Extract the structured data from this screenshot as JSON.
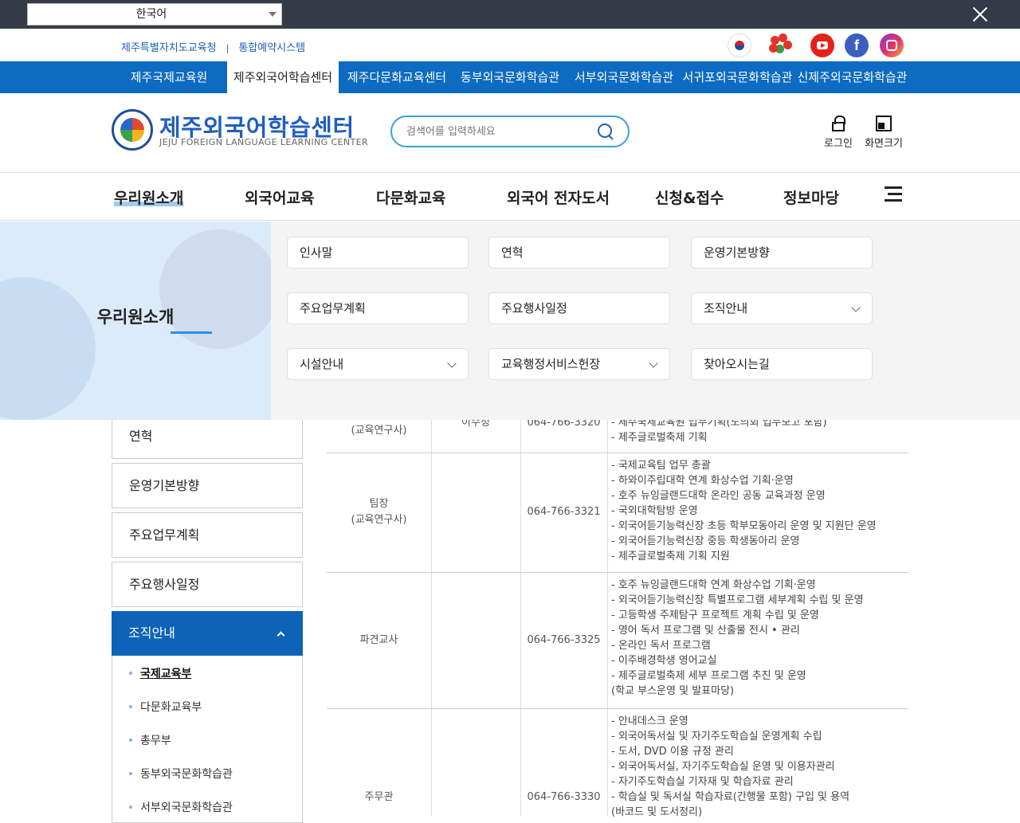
{
  "topbar": {
    "language": "한국어"
  },
  "util": {
    "links": [
      "제주특별자치도교육청",
      "통합예약시스템"
    ],
    "sep": "|"
  },
  "sites": [
    "제주국제교육원",
    "제주외국어학습센터",
    "제주다문화교육센터",
    "동부외국문화학습관",
    "서부외국문화학습관",
    "서귀포외국문화학습관",
    "신제주외국문화학습관"
  ],
  "header": {
    "logo_title": "제주외국어학습센터",
    "logo_sub": "JEJU FOREIGN LANGUAGE LEARNING CENTER",
    "search_placeholder": "검색어를 입력하세요",
    "login": "로그인",
    "zoom": "화면크기"
  },
  "gnb": [
    "우리원소개",
    "외국어교육",
    "다문화교육",
    "외국어 전자도서",
    "신청&접수",
    "정보마당"
  ],
  "mega": {
    "title": "우리원소개",
    "items": [
      "인사말",
      "연혁",
      "운영기본방향",
      "주요업무계획",
      "주요행사일정",
      "조직안내",
      "시설안내",
      "교육행정서비스헌장",
      "찾아오시는길"
    ]
  },
  "sidebar": {
    "items": [
      "연혁",
      "운영기본방향",
      "주요업무계획",
      "주요행사일정"
    ],
    "active": "조직안내",
    "sub": [
      "국제교육부",
      "다문화교육부",
      "총무부",
      "동부외국문화학습관",
      "서부외국문화학습관"
    ]
  },
  "table": {
    "rows": [
      {
        "position": "(교육연구사)",
        "name": "이수정",
        "phone": "064-766-3320",
        "duties": [
          "- 제주국제교육원 업무기획(도의회 업무보고 포함)",
          "- 제주글로벌축제 기획"
        ]
      },
      {
        "position": "팀장\n(교육연구사)",
        "name": "",
        "phone": "064-766-3321",
        "duties": [
          "- 국제교육팀 업무 총괄",
          "- 하와이주립대학 연계 화상수업 기획·운영",
          "- 호주 뉴잉글랜드대학 온라인 공동 교육과정 운영",
          "- 국외대학탐방 운영",
          "- 외국어듣기능력신장 초등 학부모동아리 운영 및 지원단 운영",
          "- 외국어듣기능력신장 중등 학생동아리 운영",
          "- 제주글로벌축제 기획 지원"
        ]
      },
      {
        "position": "파견교사",
        "name": "",
        "phone": "064-766-3325",
        "duties": [
          "- 호주 뉴잉글랜드대학 연계 화상수업 기획·운영",
          "- 외국어듣기능력신장 특별프로그램 세부계획 수립 및 운영",
          "- 고등학생 주제탐구 프로젝트 계획 수립 및 운영",
          "- 영어 독서 프로그램 및 산출물 전시 • 관리",
          "- 온라인 독서 프로그램",
          "- 이주배경학생 영어교실",
          "- 제주글로벌축제 세부 프로그램 추진 및 운영",
          " (학교 부스운영 및 발표마당)"
        ]
      },
      {
        "position": "주무관",
        "name": "",
        "phone": "064-766-3330",
        "duties": [
          "- 안내데스크 운영",
          "- 외국어독서실 및 자기주도학습실 운영계획 수립",
          "- 도서, DVD 이용 규정 관리",
          "- 외국어독서실, 자기주도학습실 운영 및 이용자관리",
          "- 자기주도학습실 기자재 및 학습자료 관리",
          "- 학습실 및 독서실 학습자료(간행물 포함) 구입 및 용역",
          " (바코드 및 도서정리)"
        ]
      }
    ]
  }
}
